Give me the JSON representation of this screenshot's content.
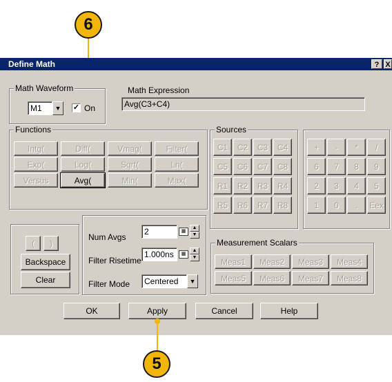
{
  "callouts": {
    "top": "6",
    "bottom": "5"
  },
  "dialog": {
    "title": "Define Math",
    "help_glyph": "?",
    "close_glyph": "X"
  },
  "math_waveform": {
    "group_label": "Math Waveform",
    "selected": "M1",
    "checkbox_label": "On",
    "checked": true
  },
  "math_expression": {
    "label": "Math Expression",
    "value": "Avg(C3+C4)"
  },
  "functions": {
    "label": "Functions",
    "items": [
      "Intg(",
      "Diff(",
      "Vmag(",
      "Filter(",
      "Exp(",
      "Log(",
      "Sqrt(",
      "Ln(",
      "Versus",
      "Avg(",
      "Min(",
      "Max("
    ]
  },
  "sources": {
    "label": "Sources",
    "items": [
      "C1",
      "C2",
      "C3",
      "C4",
      "C5",
      "C6",
      "C7",
      "C8",
      "R1",
      "R2",
      "R3",
      "R4",
      "R5",
      "R6",
      "R7",
      "R8"
    ]
  },
  "keypad": {
    "items": [
      "+",
      "-",
      "*",
      "/",
      "6",
      "7",
      "8",
      "9",
      "2",
      "3",
      "4",
      "5",
      "1",
      "0",
      ".",
      "Eex"
    ]
  },
  "edit": {
    "open_paren": "(",
    "close_paren": ")",
    "backspace": "Backspace",
    "clear": "Clear"
  },
  "settings": {
    "num_avgs_label": "Num Avgs",
    "num_avgs_value": "2",
    "filter_risetime_label": "Filter Risetime",
    "filter_risetime_value": "1.000ns",
    "filter_mode_label": "Filter Mode",
    "filter_mode_value": "Centered"
  },
  "measurement_scalars": {
    "label": "Measurement Scalars",
    "items": [
      "Meas1",
      "Meas2",
      "Meas3",
      "Meas4",
      "Meas5",
      "Meas6",
      "Meas7",
      "Meas8"
    ]
  },
  "footer": {
    "ok": "OK",
    "apply": "Apply",
    "cancel": "Cancel",
    "help": "Help"
  }
}
